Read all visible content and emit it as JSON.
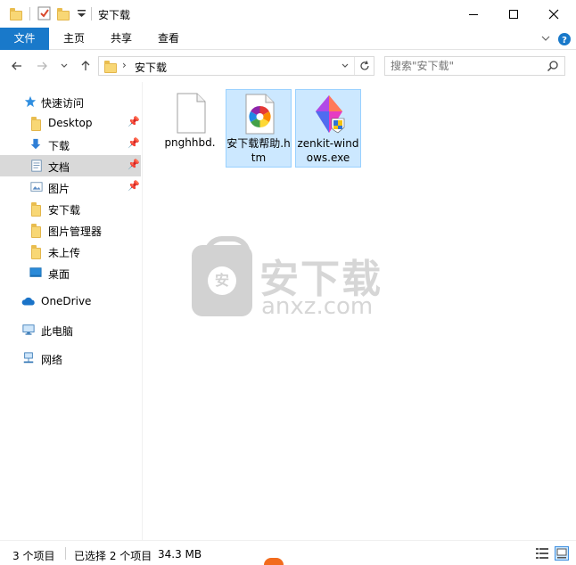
{
  "window": {
    "title": "安下载"
  },
  "ribbon": {
    "tabs": [
      {
        "label": "文件"
      },
      {
        "label": "主页"
      },
      {
        "label": "共享"
      },
      {
        "label": "查看"
      }
    ]
  },
  "address": {
    "path": "安下载",
    "search_placeholder": "搜索\"安下载\""
  },
  "nav": {
    "items": [
      {
        "label": "快速访问",
        "icon": "star-icon",
        "pinned": false
      },
      {
        "label": "Desktop",
        "icon": "folder-icon",
        "pinned": true
      },
      {
        "label": "下载",
        "icon": "download-icon",
        "pinned": true
      },
      {
        "label": "文档",
        "icon": "document-icon",
        "pinned": true
      },
      {
        "label": "图片",
        "icon": "picture-icon",
        "pinned": true
      },
      {
        "label": "安下载",
        "icon": "folder-icon",
        "pinned": false
      },
      {
        "label": "图片管理器",
        "icon": "folder-icon",
        "pinned": false
      },
      {
        "label": "未上传",
        "icon": "folder-icon",
        "pinned": false
      },
      {
        "label": "桌面",
        "icon": "desktop-icon",
        "pinned": false
      },
      {
        "label": "OneDrive",
        "icon": "cloud-icon",
        "pinned": false
      },
      {
        "label": "此电脑",
        "icon": "computer-icon",
        "pinned": false
      },
      {
        "label": "网络",
        "icon": "network-icon",
        "pinned": false
      }
    ]
  },
  "files": [
    {
      "name": "pnghhbd.",
      "icon": "blank-file-icon",
      "selected": false
    },
    {
      "name": "安下载帮助.htm",
      "icon": "htm-file-icon",
      "selected": true
    },
    {
      "name": "zenkit-windows.exe",
      "icon": "exe-file-icon",
      "selected": true
    }
  ],
  "watermark": {
    "badge": "安",
    "title": "安下载",
    "subtitle": "anxz.com"
  },
  "status": {
    "item_count": "3 个项目",
    "selected": "已选择 2 个项目",
    "size": "34.3 MB"
  },
  "colors": {
    "accent": "#1979ca",
    "selection_bg": "#cce8ff",
    "selection_border": "#99d1ff",
    "folder": "#f8d775"
  }
}
